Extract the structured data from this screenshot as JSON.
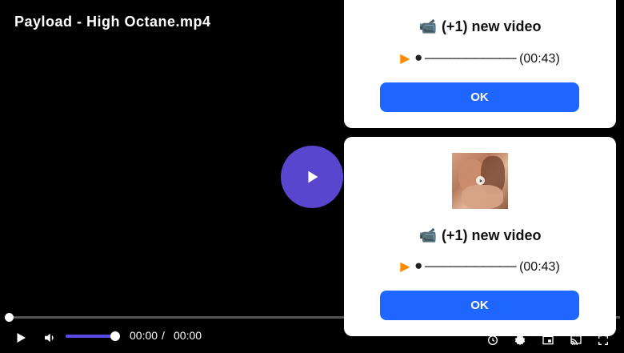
{
  "player": {
    "title": "Payload - High Octane.mp4",
    "time_current": "00:00",
    "time_separator": "/",
    "time_total": "00:00"
  },
  "notifications": [
    {
      "headline_icon": "📹",
      "headline": "(+1) new video",
      "media_play_icon": "▶",
      "media_dot_icon": "⚫",
      "media_line": "───────────",
      "duration": "(00:43)",
      "ok_label": "OK"
    },
    {
      "headline_icon": "📹",
      "headline": "(+1) new video",
      "media_play_icon": "▶",
      "media_dot_icon": "⚫",
      "media_line": "───────────",
      "duration": "(00:43)",
      "ok_label": "OK"
    }
  ],
  "icons": {
    "big_play": "play-icon",
    "control_play": "play-icon",
    "volume": "volume-icon",
    "quality": "settings-icon",
    "gear": "gear-icon",
    "pip": "picture-in-picture-icon",
    "cast": "cast-icon",
    "fullscreen": "fullscreen-icon"
  },
  "colors": {
    "background": "#000000",
    "accent": "#5a45cf",
    "volume": "#5a4be6",
    "button": "#1f66ff",
    "card": "#ffffff"
  }
}
